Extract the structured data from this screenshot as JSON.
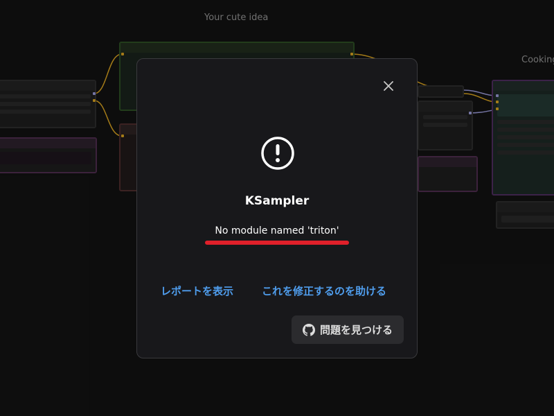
{
  "background": {
    "group_left_title": "Your cute idea",
    "group_right_title": "Cooking"
  },
  "dialog": {
    "node_name": "KSampler",
    "error_message": "No module named 'triton'",
    "show_report_label": "レポートを表示",
    "help_fix_label": "これを修正するのを助ける",
    "find_issues_label": "問題を見つける",
    "icons": {
      "close": "close-icon",
      "warning": "exclamation-circle-icon",
      "github": "github-icon"
    }
  },
  "colors": {
    "link": "#4f9ded",
    "underline": "#e0202a",
    "dialog_bg": "#18181b"
  }
}
